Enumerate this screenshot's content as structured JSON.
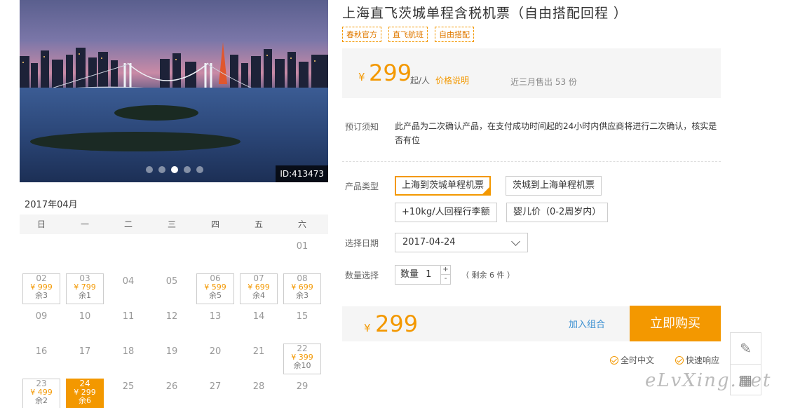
{
  "hero": {
    "image_id": "ID:413473",
    "carousel_dots": 5,
    "active_dot": 3
  },
  "calendar": {
    "month": "2017年04月",
    "weekdays": [
      "日",
      "一",
      "二",
      "三",
      "四",
      "五",
      "六"
    ],
    "cells": [
      {
        "day": ""
      },
      {
        "day": ""
      },
      {
        "day": ""
      },
      {
        "day": ""
      },
      {
        "day": ""
      },
      {
        "day": ""
      },
      {
        "day": "01"
      },
      {
        "day": "02",
        "price": "¥ 999",
        "stock": "余3"
      },
      {
        "day": "03",
        "price": "¥ 799",
        "stock": "余1"
      },
      {
        "day": "04"
      },
      {
        "day": "05"
      },
      {
        "day": "06",
        "price": "¥ 599",
        "stock": "余5"
      },
      {
        "day": "07",
        "price": "¥ 699",
        "stock": "余4"
      },
      {
        "day": "08",
        "price": "¥ 699",
        "stock": "余3"
      },
      {
        "day": "09"
      },
      {
        "day": "10"
      },
      {
        "day": "11"
      },
      {
        "day": "12"
      },
      {
        "day": "13"
      },
      {
        "day": "14"
      },
      {
        "day": "15"
      },
      {
        "day": "16"
      },
      {
        "day": "17"
      },
      {
        "day": "18"
      },
      {
        "day": "19"
      },
      {
        "day": "20"
      },
      {
        "day": "21"
      },
      {
        "day": "22",
        "price": "¥ 399",
        "stock": "余10"
      },
      {
        "day": "23",
        "price": "¥ 499",
        "stock": "余2"
      },
      {
        "day": "24",
        "price": "¥ 299",
        "stock": "余6",
        "selected": true
      },
      {
        "day": "25"
      },
      {
        "day": "26"
      },
      {
        "day": "27"
      },
      {
        "day": "28"
      },
      {
        "day": "29"
      }
    ]
  },
  "product": {
    "title": "上海直飞茨城单程含税机票（自由搭配回程 ）",
    "tags": [
      "春秋官方",
      "直飞航班",
      "自由搭配"
    ],
    "price_currency": "¥",
    "price": "299",
    "price_unit": "起/人",
    "price_explain": "价格说明",
    "sold": "近三月售出 53 份"
  },
  "notice": {
    "label": "预订须知",
    "text": "此产品为二次确认产品，在支付成功时间起的24小时内供应商将进行二次确认，核实是否有位"
  },
  "options": {
    "type_label": "产品类型",
    "items": [
      "上海到茨城单程机票",
      "茨城到上海单程机票",
      "+10kg/人回程行李额",
      "婴儿价（0-2周岁内）"
    ],
    "selected_index": 0
  },
  "date": {
    "label": "选择日期",
    "value": "2017-04-24"
  },
  "quantity": {
    "label": "数量选择",
    "field_label": "数量",
    "value": "1",
    "plus": "+",
    "minus": "-",
    "remain": "（ 剩余 6 件 ）"
  },
  "buy": {
    "currency": "¥",
    "total": "299",
    "combo_label": "加入组合",
    "button_label": "立即购买"
  },
  "badges": [
    "全时中文",
    "快速响应"
  ],
  "watermark": "eLvXing.net",
  "colors": {
    "accent": "#f39800",
    "link": "#3a8fd1"
  }
}
